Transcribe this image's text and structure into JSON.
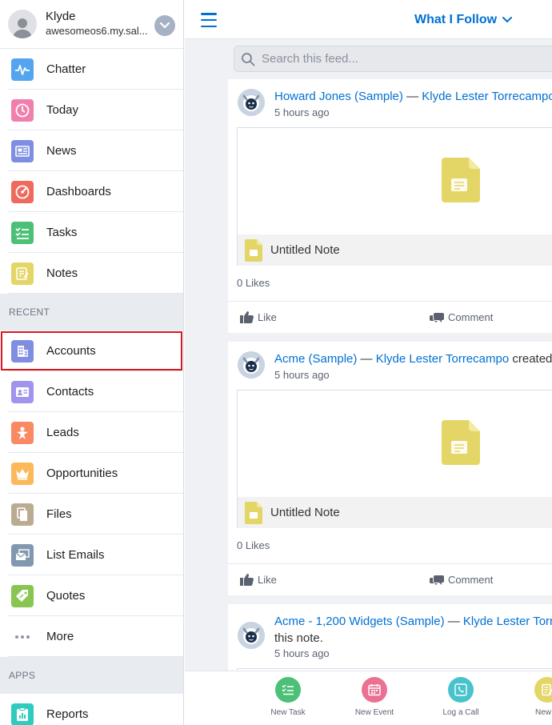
{
  "user": {
    "name": "Klyde",
    "domain": "awesomeos6.my.sal..."
  },
  "nav": {
    "items": [
      {
        "label": "Chatter",
        "icon": "chatter-pulse-icon",
        "color": "#54a4f0"
      },
      {
        "label": "Today",
        "icon": "clock-icon",
        "color": "#f07fad"
      },
      {
        "label": "News",
        "icon": "news-icon",
        "color": "#7f8ee0"
      },
      {
        "label": "Dashboards",
        "icon": "dashboard-icon",
        "color": "#ee6a5e"
      },
      {
        "label": "Tasks",
        "icon": "tasks-icon",
        "color": "#4bc076"
      },
      {
        "label": "Notes",
        "icon": "notes-icon",
        "color": "#e4d567"
      }
    ],
    "recent_heading": "RECENT",
    "recent": [
      {
        "label": "Accounts",
        "icon": "accounts-icon",
        "color": "#7f8ee0"
      },
      {
        "label": "Contacts",
        "icon": "contacts-icon",
        "color": "#a094ed"
      },
      {
        "label": "Leads",
        "icon": "leads-icon",
        "color": "#f88962"
      },
      {
        "label": "Opportunities",
        "icon": "opportunities-crown-icon",
        "color": "#fcb95b"
      },
      {
        "label": "Files",
        "icon": "files-icon",
        "color": "#baac93"
      },
      {
        "label": "List Emails",
        "icon": "list-emails-icon",
        "color": "#8199af"
      },
      {
        "label": "Quotes",
        "icon": "quotes-icon",
        "color": "#88c651"
      },
      {
        "label": "More",
        "icon": "more-dots-icon"
      }
    ],
    "apps_heading": "APPS",
    "apps": [
      {
        "label": "Reports",
        "icon": "reports-icon",
        "color": "#2ecbbe"
      }
    ]
  },
  "header": {
    "title": "What I Follow"
  },
  "search": {
    "placeholder": "Search this feed..."
  },
  "posts": [
    {
      "author": "Howard Jones (Sample)",
      "sep": " — ",
      "actor": "Klyde Lester Torrecampo",
      "tail": " c",
      "time": "5 hours ago",
      "attachment": "Untitled Note",
      "likes": "0 Likes",
      "like": "Like",
      "comment": "Comment"
    },
    {
      "author": "Acme (Sample)",
      "sep": " — ",
      "actor": "Klyde Lester Torrecampo",
      "tail": " created th",
      "time": "5 hours ago",
      "attachment": "Untitled Note",
      "likes": "0 Likes",
      "like": "Like",
      "comment": "Comment"
    },
    {
      "author": "Acme - 1,200 Widgets (Sample)",
      "sep": " — ",
      "actor": "Klyde Lester Torrec",
      "line2": "this note.",
      "time": "5 hours ago"
    }
  ],
  "quick_actions": [
    {
      "label": "New Task",
      "color": "#4bc076",
      "icon": "new-task-icon"
    },
    {
      "label": "New Event",
      "color": "#eb7092",
      "icon": "new-event-icon"
    },
    {
      "label": "Log a Call",
      "color": "#48c3cc",
      "icon": "log-call-icon"
    },
    {
      "label": "New N",
      "color": "#e4d567",
      "icon": "new-note-icon"
    }
  ],
  "colors": {
    "accent": "#0070d2",
    "selected_outline": "#d9171f"
  }
}
